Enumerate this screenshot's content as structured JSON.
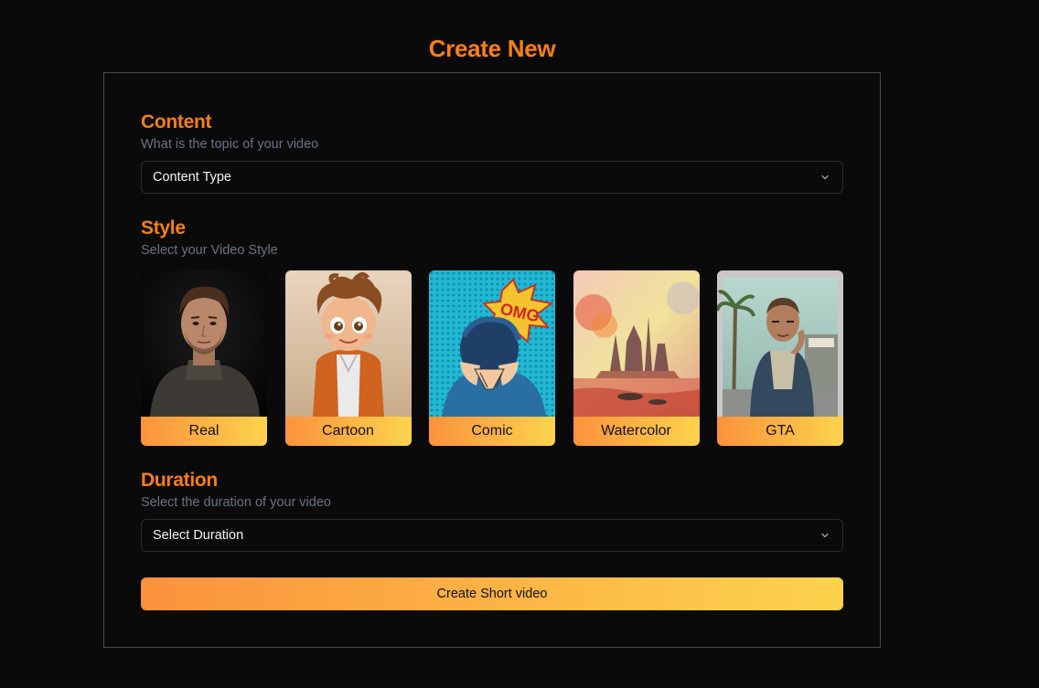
{
  "page": {
    "title": "Create New"
  },
  "content": {
    "title": "Content",
    "subtitle": "What is the topic of your video",
    "select_value": "Content Type",
    "chevron_icon": "chevron-down-icon"
  },
  "style": {
    "title": "Style",
    "subtitle": "Select your Video Style",
    "options": [
      {
        "label": "Real",
        "image": "portrait-photo"
      },
      {
        "label": "Cartoon",
        "image": "cartoon-boy-illustration"
      },
      {
        "label": "Comic",
        "image": "pop-art-omg-comic"
      },
      {
        "label": "Watercolor",
        "image": "watercolor-city-painting"
      },
      {
        "label": "GTA",
        "image": "gta-character-art"
      }
    ]
  },
  "duration": {
    "title": "Duration",
    "subtitle": "Select the duration of your video",
    "select_value": "Select Duration",
    "chevron_icon": "chevron-down-icon"
  },
  "cta": {
    "label": "Create Short video"
  },
  "colors": {
    "accent": "#f97f12",
    "gradient_start": "#fb923c",
    "gradient_end": "#fcd34d",
    "background": "#0a0a0b"
  }
}
